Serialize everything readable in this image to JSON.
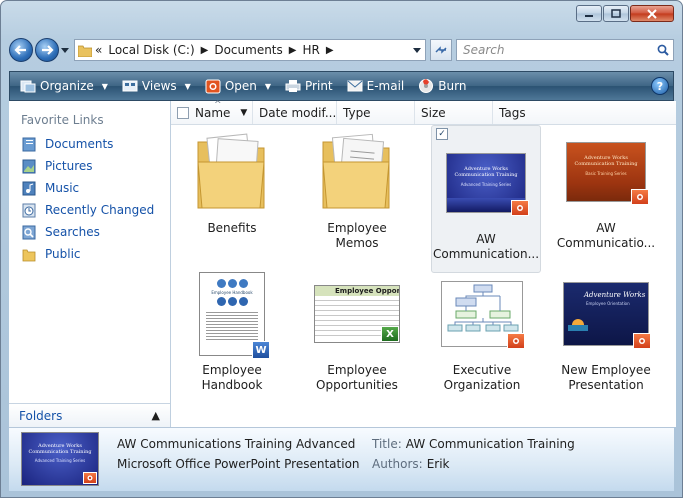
{
  "window": {
    "caption_buttons": [
      "minimize",
      "maximize",
      "close"
    ]
  },
  "address": {
    "crumbs": [
      "Local Disk (C:)",
      "Documents",
      "HR"
    ],
    "overflow": "«",
    "search_placeholder": "Search"
  },
  "toolbar": {
    "items": [
      {
        "label": "Organize",
        "icon": "organize-icon",
        "dropdown": true
      },
      {
        "label": "Views",
        "icon": "views-icon",
        "dropdown": true
      },
      {
        "label": "Open",
        "icon": "powerpoint-icon",
        "dropdown": true
      },
      {
        "label": "Print",
        "icon": "printer-icon",
        "dropdown": false
      },
      {
        "label": "E-mail",
        "icon": "email-icon",
        "dropdown": false
      },
      {
        "label": "Burn",
        "icon": "burn-icon",
        "dropdown": false
      }
    ],
    "help_label": "?"
  },
  "nav_pane": {
    "title": "Favorite Links",
    "items": [
      {
        "label": "Documents",
        "icon": "documents-icon"
      },
      {
        "label": "Pictures",
        "icon": "pictures-icon"
      },
      {
        "label": "Music",
        "icon": "music-icon"
      },
      {
        "label": "Recently Changed",
        "icon": "recently-changed-icon"
      },
      {
        "label": "Searches",
        "icon": "searches-icon"
      },
      {
        "label": "Public",
        "icon": "public-folder-icon"
      }
    ],
    "folders_label": "Folders"
  },
  "columns": [
    "Name",
    "Date modif...",
    "Type",
    "Size",
    "Tags"
  ],
  "files": [
    {
      "label": "Benefits",
      "kind": "folder"
    },
    {
      "label": "Employee Memos",
      "kind": "folder"
    },
    {
      "label": "AW Communication...",
      "kind": "ppt-blue",
      "selected": true,
      "slide_title": "Adventure Works Communication Training",
      "slide_sub": "Advanced Training Series"
    },
    {
      "label": "AW Communicatio...",
      "kind": "ppt-orange",
      "slide_title": "Adventure Works Communication Training",
      "slide_sub": "Basic Training Series"
    },
    {
      "label": "Employee Handbook",
      "kind": "word",
      "doc_title": "Employee Handbook"
    },
    {
      "label": "Employee Opportunities",
      "kind": "excel",
      "sheet_title": "Employee Oppor"
    },
    {
      "label": "Executive Organization",
      "kind": "ppt-org"
    },
    {
      "label": "New Employee Presentation",
      "kind": "ppt-navy",
      "slide_title": "Adventure Works",
      "slide_sub": "Employee Orientation"
    }
  ],
  "details": {
    "file_name": "AW Communications Training Advanced",
    "file_type": "Microsoft Office PowerPoint Presentation",
    "props": [
      {
        "label": "Title:",
        "value": "AW Communication Training"
      },
      {
        "label": "Authors:",
        "value": "Erik"
      }
    ],
    "thumb_title": "Adventure Works Communication Training",
    "thumb_sub": "Advanced Training Series"
  }
}
